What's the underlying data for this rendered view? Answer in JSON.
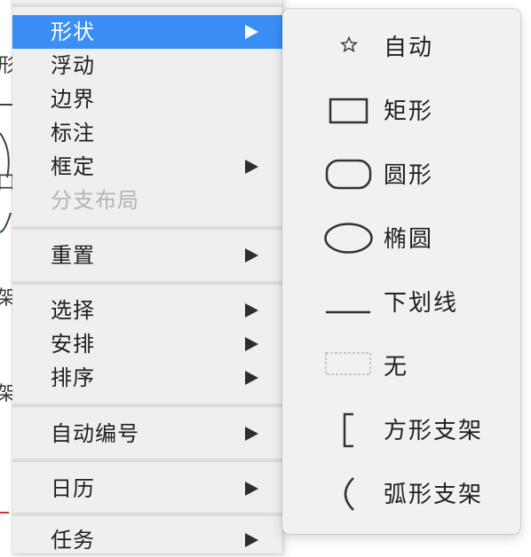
{
  "background": {
    "fragments": [
      "形",
      "口",
      "架",
      "架"
    ]
  },
  "menu": {
    "items": [
      {
        "label": "形状",
        "submenu": true,
        "selected": true,
        "disabled": false
      },
      {
        "label": "浮动",
        "submenu": false,
        "selected": false,
        "disabled": false
      },
      {
        "label": "边界",
        "submenu": false,
        "selected": false,
        "disabled": false
      },
      {
        "label": "标注",
        "submenu": false,
        "selected": false,
        "disabled": false
      },
      {
        "label": "框定",
        "submenu": true,
        "selected": false,
        "disabled": false
      },
      {
        "label": "分支布局",
        "submenu": false,
        "selected": false,
        "disabled": true
      },
      {
        "label": "重置",
        "submenu": true,
        "selected": false,
        "disabled": false
      },
      {
        "label": "选择",
        "submenu": true,
        "selected": false,
        "disabled": false
      },
      {
        "label": "安排",
        "submenu": true,
        "selected": false,
        "disabled": false
      },
      {
        "label": "排序",
        "submenu": true,
        "selected": false,
        "disabled": false
      },
      {
        "label": "自动编号",
        "submenu": true,
        "selected": false,
        "disabled": false
      },
      {
        "label": "日历",
        "submenu": true,
        "selected": false,
        "disabled": false
      },
      {
        "label": "任务",
        "submenu": true,
        "selected": false,
        "disabled": false
      }
    ]
  },
  "submenu": {
    "items": [
      {
        "label": "自动",
        "icon": "star-icon"
      },
      {
        "label": "矩形",
        "icon": "rectangle-icon"
      },
      {
        "label": "圆形",
        "icon": "rounded-rectangle-icon"
      },
      {
        "label": "椭圆",
        "icon": "ellipse-icon"
      },
      {
        "label": "下划线",
        "icon": "underline-icon"
      },
      {
        "label": "无",
        "icon": "none-dashed-icon"
      },
      {
        "label": "方形支架",
        "icon": "square-bracket-icon"
      },
      {
        "label": "弧形支架",
        "icon": "arc-bracket-icon"
      }
    ]
  },
  "colors": {
    "selection": "#3a8ef6",
    "menu_bg": "#efefef",
    "disabled_text": "#b4b4b4"
  }
}
